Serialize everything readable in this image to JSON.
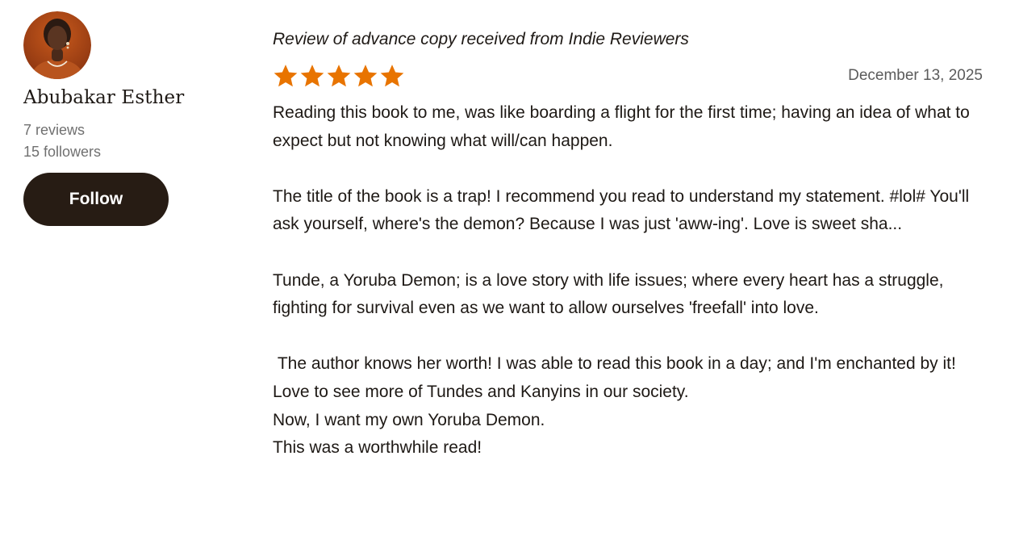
{
  "reviewer": {
    "name": "Abubakar Esther",
    "reviews_count": "7 reviews",
    "followers_count": "15 followers",
    "follow_label": "Follow",
    "avatar_icon": "reviewer-avatar-photo"
  },
  "review": {
    "source_note": "Review of advance copy received from Indie Reviewers",
    "rating": 5,
    "rating_max": 5,
    "star_color": "#e87400",
    "date": "December 13, 2025",
    "paragraphs": [
      [
        "Reading this book to me, was like boarding a flight for the first time; having an idea of what to expect but not knowing what will/can happen."
      ],
      [
        "The title of the book is a trap! I recommend you read to understand my statement. #lol# You'll ask yourself, where's the demon? Because I was just 'aww-ing'. Love is sweet sha..."
      ],
      [
        "Tunde, a Yoruba Demon; is a love story with life issues; where every heart has a struggle, fighting for survival even as we want to allow ourselves 'freefall' into love."
      ],
      [
        " The author knows her worth! I was able to read this book in a day; and I'm enchanted by it!",
        "Love to see more of Tundes and Kanyins in our society.",
        "Now, I want my own Yoruba Demon.",
        "This was a worthwhile read!"
      ]
    ]
  },
  "colors": {
    "button_bg": "#271c14",
    "text": "#1e1915",
    "muted_text": "#707070"
  }
}
